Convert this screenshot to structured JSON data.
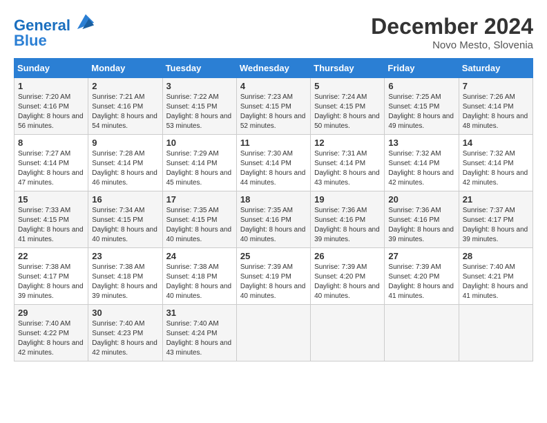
{
  "header": {
    "logo_line1": "General",
    "logo_line2": "Blue",
    "month": "December 2024",
    "location": "Novo Mesto, Slovenia"
  },
  "days_of_week": [
    "Sunday",
    "Monday",
    "Tuesday",
    "Wednesday",
    "Thursday",
    "Friday",
    "Saturday"
  ],
  "weeks": [
    [
      {
        "day": "1",
        "sunrise": "7:20 AM",
        "sunset": "4:16 PM",
        "daylight": "8 hours and 56 minutes."
      },
      {
        "day": "2",
        "sunrise": "7:21 AM",
        "sunset": "4:16 PM",
        "daylight": "8 hours and 54 minutes."
      },
      {
        "day": "3",
        "sunrise": "7:22 AM",
        "sunset": "4:15 PM",
        "daylight": "8 hours and 53 minutes."
      },
      {
        "day": "4",
        "sunrise": "7:23 AM",
        "sunset": "4:15 PM",
        "daylight": "8 hours and 52 minutes."
      },
      {
        "day": "5",
        "sunrise": "7:24 AM",
        "sunset": "4:15 PM",
        "daylight": "8 hours and 50 minutes."
      },
      {
        "day": "6",
        "sunrise": "7:25 AM",
        "sunset": "4:15 PM",
        "daylight": "8 hours and 49 minutes."
      },
      {
        "day": "7",
        "sunrise": "7:26 AM",
        "sunset": "4:14 PM",
        "daylight": "8 hours and 48 minutes."
      }
    ],
    [
      {
        "day": "8",
        "sunrise": "7:27 AM",
        "sunset": "4:14 PM",
        "daylight": "8 hours and 47 minutes."
      },
      {
        "day": "9",
        "sunrise": "7:28 AM",
        "sunset": "4:14 PM",
        "daylight": "8 hours and 46 minutes."
      },
      {
        "day": "10",
        "sunrise": "7:29 AM",
        "sunset": "4:14 PM",
        "daylight": "8 hours and 45 minutes."
      },
      {
        "day": "11",
        "sunrise": "7:30 AM",
        "sunset": "4:14 PM",
        "daylight": "8 hours and 44 minutes."
      },
      {
        "day": "12",
        "sunrise": "7:31 AM",
        "sunset": "4:14 PM",
        "daylight": "8 hours and 43 minutes."
      },
      {
        "day": "13",
        "sunrise": "7:32 AM",
        "sunset": "4:14 PM",
        "daylight": "8 hours and 42 minutes."
      },
      {
        "day": "14",
        "sunrise": "7:32 AM",
        "sunset": "4:14 PM",
        "daylight": "8 hours and 42 minutes."
      }
    ],
    [
      {
        "day": "15",
        "sunrise": "7:33 AM",
        "sunset": "4:15 PM",
        "daylight": "8 hours and 41 minutes."
      },
      {
        "day": "16",
        "sunrise": "7:34 AM",
        "sunset": "4:15 PM",
        "daylight": "8 hours and 40 minutes."
      },
      {
        "day": "17",
        "sunrise": "7:35 AM",
        "sunset": "4:15 PM",
        "daylight": "8 hours and 40 minutes."
      },
      {
        "day": "18",
        "sunrise": "7:35 AM",
        "sunset": "4:16 PM",
        "daylight": "8 hours and 40 minutes."
      },
      {
        "day": "19",
        "sunrise": "7:36 AM",
        "sunset": "4:16 PM",
        "daylight": "8 hours and 39 minutes."
      },
      {
        "day": "20",
        "sunrise": "7:36 AM",
        "sunset": "4:16 PM",
        "daylight": "8 hours and 39 minutes."
      },
      {
        "day": "21",
        "sunrise": "7:37 AM",
        "sunset": "4:17 PM",
        "daylight": "8 hours and 39 minutes."
      }
    ],
    [
      {
        "day": "22",
        "sunrise": "7:38 AM",
        "sunset": "4:17 PM",
        "daylight": "8 hours and 39 minutes."
      },
      {
        "day": "23",
        "sunrise": "7:38 AM",
        "sunset": "4:18 PM",
        "daylight": "8 hours and 39 minutes."
      },
      {
        "day": "24",
        "sunrise": "7:38 AM",
        "sunset": "4:18 PM",
        "daylight": "8 hours and 40 minutes."
      },
      {
        "day": "25",
        "sunrise": "7:39 AM",
        "sunset": "4:19 PM",
        "daylight": "8 hours and 40 minutes."
      },
      {
        "day": "26",
        "sunrise": "7:39 AM",
        "sunset": "4:20 PM",
        "daylight": "8 hours and 40 minutes."
      },
      {
        "day": "27",
        "sunrise": "7:39 AM",
        "sunset": "4:20 PM",
        "daylight": "8 hours and 41 minutes."
      },
      {
        "day": "28",
        "sunrise": "7:40 AM",
        "sunset": "4:21 PM",
        "daylight": "8 hours and 41 minutes."
      }
    ],
    [
      {
        "day": "29",
        "sunrise": "7:40 AM",
        "sunset": "4:22 PM",
        "daylight": "8 hours and 42 minutes."
      },
      {
        "day": "30",
        "sunrise": "7:40 AM",
        "sunset": "4:23 PM",
        "daylight": "8 hours and 42 minutes."
      },
      {
        "day": "31",
        "sunrise": "7:40 AM",
        "sunset": "4:24 PM",
        "daylight": "8 hours and 43 minutes."
      },
      null,
      null,
      null,
      null
    ]
  ],
  "labels": {
    "sunrise": "Sunrise:",
    "sunset": "Sunset:",
    "daylight": "Daylight:"
  }
}
